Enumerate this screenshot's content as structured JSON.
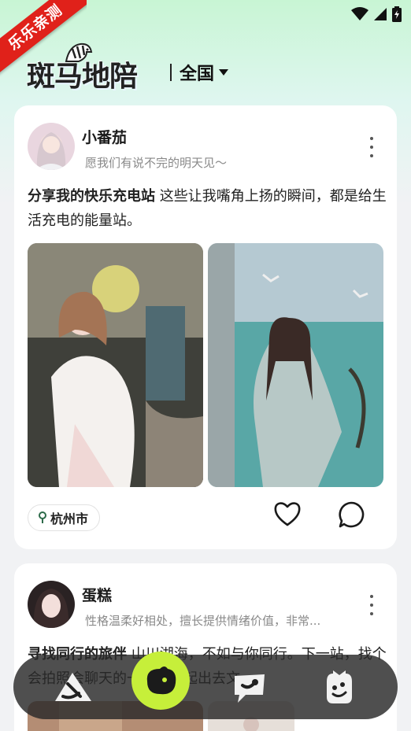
{
  "status_bar": {
    "icons": [
      "wifi-icon",
      "signal-icon",
      "battery-icon"
    ]
  },
  "ribbon": {
    "label": "乐乐亲测"
  },
  "header": {
    "logo_text": "斑马地陪",
    "region": "全国"
  },
  "posts": [
    {
      "name": "小番茄",
      "bio": "愿我们有说不完的明天见～",
      "title": "分享我的快乐充电站",
      "body": " 这些让我嘴角上扬的瞬间，都是给生活充电的能量站。",
      "location": "杭州市"
    },
    {
      "name": "蛋糕",
      "bio": "性格温柔好相处，擅长提供情绪价值，非常...",
      "title": "寻找同行的旅伴",
      "body": " 山川湖海，不如与你同行。下一站，找个会拍照会聊天的一起要一起出去文"
    }
  ],
  "colors": {
    "accent": "#c6ef3a",
    "ribbon": "#e0211a",
    "nav_bg": "#282828"
  }
}
